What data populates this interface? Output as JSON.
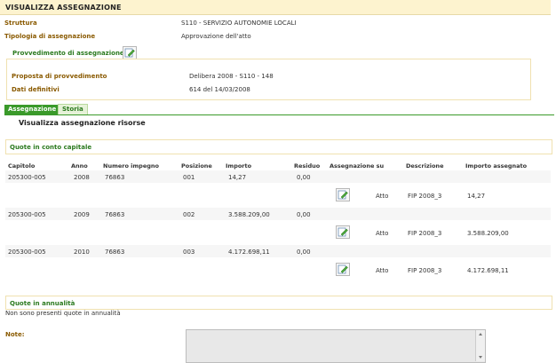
{
  "header": {
    "title": "VISUALIZZA ASSEGNAZIONE"
  },
  "fields": {
    "struttura_label": "Struttura",
    "struttura_value": "S110 - SERVIZIO AUTONOMIE LOCALI",
    "tipologia_label": "Tipologia di assegnazione",
    "tipologia_value": "Approvazione dell'atto"
  },
  "provvedimento": {
    "title": "Provvedimento di assegnazione",
    "proposta_label": "Proposta di provvedimento",
    "proposta_value": "Delibera 2008 - S110 - 148",
    "dati_label": "Dati definitivi",
    "dati_value": "614 del 14/03/2008"
  },
  "tabs": [
    {
      "label": "Assegnazione"
    },
    {
      "label": "Storia"
    }
  ],
  "section_title": "Visualizza assegnazione risorse",
  "conto_capitale": {
    "title": "Quote in conto capitale",
    "columns": [
      "Capitolo",
      "Anno",
      "Numero impegno",
      "Posizione",
      "Importo",
      "Residuo",
      "Assegnazione su",
      "Descrizione",
      "Importo assegnato"
    ],
    "rows": [
      {
        "capitolo": "205300-005",
        "anno": "2008",
        "numero": "76863",
        "posizione": "001",
        "importo": "14,27",
        "residuo": "0,00",
        "assegnazione": "Atto",
        "descrizione": "FIP 2008_3",
        "importo_assegnato": "14,27"
      },
      {
        "capitolo": "205300-005",
        "anno": "2009",
        "numero": "76863",
        "posizione": "002",
        "importo": "3.588.209,00",
        "residuo": "0,00",
        "assegnazione": "Atto",
        "descrizione": "FIP 2008_3",
        "importo_assegnato": "3.588.209,00"
      },
      {
        "capitolo": "205300-005",
        "anno": "2010",
        "numero": "76863",
        "posizione": "003",
        "importo": "4.172.698,11",
        "residuo": "0,00",
        "assegnazione": "Atto",
        "descrizione": "FIP 2008_3",
        "importo_assegnato": "4.172.698,11"
      }
    ]
  },
  "annualita": {
    "title": "Quote in annualità",
    "empty_text": "Non sono presenti quote in annualità"
  },
  "note": {
    "label": "Note:",
    "value": ""
  },
  "colors": {
    "header_bg": "#fdf3cf",
    "green": "#3a9a2a",
    "brown": "#8a5a00"
  }
}
